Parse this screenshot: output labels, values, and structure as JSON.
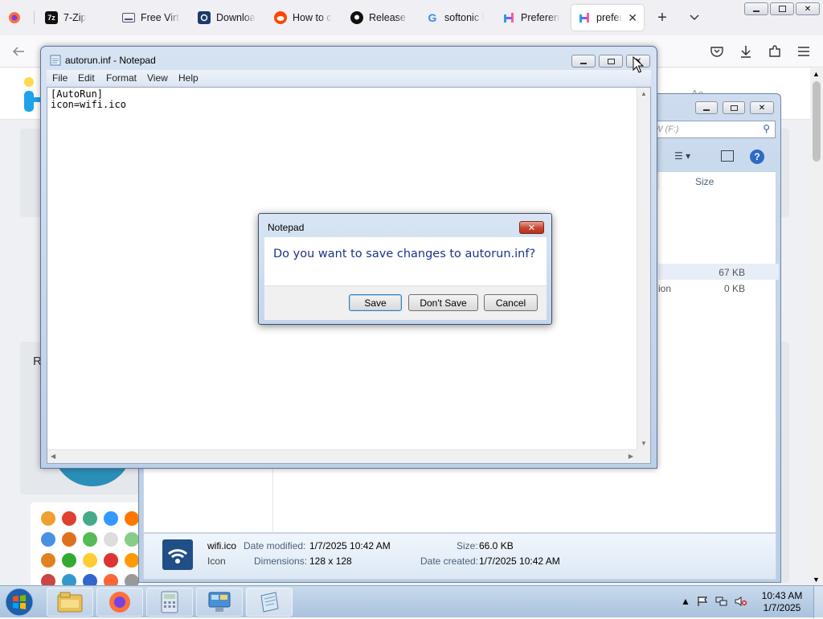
{
  "browser": {
    "tabs": [
      {
        "label": "",
        "icon": "firefox-icon"
      },
      {
        "label": "7-Zip",
        "icon": "7zip-icon"
      },
      {
        "label": "Free Virtu",
        "icon": "keyboard-icon"
      },
      {
        "label": "Downloa",
        "icon": "download-site-icon"
      },
      {
        "label": "How to c",
        "icon": "reddit-icon"
      },
      {
        "label": "Release o",
        "icon": "github-icon"
      },
      {
        "label": "softonic l",
        "icon": "google-icon"
      },
      {
        "label": "Preferenc",
        "icon": "h-logo-icon"
      },
      {
        "label": "prefere",
        "icon": "h-logo-icon",
        "active": true
      }
    ],
    "new_tab": "+",
    "accent": "#0060df"
  },
  "page": {
    "partial_text": [
      "Ac",
      "R"
    ]
  },
  "explorer": {
    "search_placeholder": "W (F:)",
    "column_size": "Size",
    "rows": [
      {
        "name": "",
        "size": "67 KB"
      },
      {
        "name": "ion",
        "size": "0 KB"
      }
    ],
    "details": {
      "filename": "wifi.ico",
      "type": "Icon",
      "modified_label": "Date modified:",
      "modified_value": "1/7/2025 10:42 AM",
      "dimensions_label": "Dimensions:",
      "dimensions_value": "128 x 128",
      "size_label": "Size:",
      "size_value": "66.0 KB",
      "created_label": "Date created:",
      "created_value": "1/7/2025 10:42 AM"
    }
  },
  "notepad": {
    "title": "autorun.inf - Notepad",
    "menu": [
      "File",
      "Edit",
      "Format",
      "View",
      "Help"
    ],
    "content": "[AutoRun]\nicon=wifi.ico"
  },
  "dialog": {
    "title": "Notepad",
    "message": "Do you want to save changes to autorun.inf?",
    "buttons": {
      "save": "Save",
      "dont_save": "Don't Save",
      "cancel": "Cancel"
    }
  },
  "taskbar": {
    "time": "10:43 AM",
    "date": "1/7/2025",
    "items": [
      "file-explorer-icon",
      "firefox-icon",
      "calculator-icon",
      "control-panel-icon",
      "notepad-icon"
    ]
  }
}
